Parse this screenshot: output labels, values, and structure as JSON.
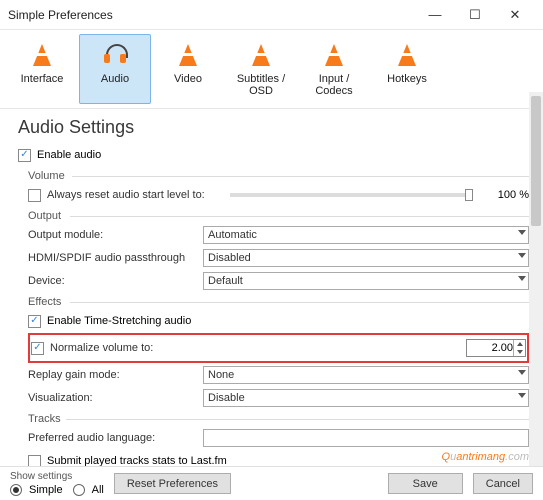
{
  "window": {
    "title": "Simple Preferences"
  },
  "tabs": {
    "interface": "Interface",
    "audio": "Audio",
    "video": "Video",
    "subtitles": "Subtitles / OSD",
    "input_codecs": "Input / Codecs",
    "hotkeys": "Hotkeys"
  },
  "page": {
    "heading": "Audio Settings",
    "enable_audio": "Enable audio",
    "volume_section": "Volume",
    "always_reset": "Always reset audio start level to:",
    "level_pct": "100 %",
    "output_section": "Output",
    "output_module": "Output module:",
    "output_module_val": "Automatic",
    "hdmi": "HDMI/SPDIF audio passthrough",
    "hdmi_val": "Disabled",
    "device": "Device:",
    "device_val": "Default",
    "effects_section": "Effects",
    "time_stretch": "Enable Time-Stretching audio",
    "normalize": "Normalize volume to:",
    "normalize_val": "2.00",
    "replay_gain": "Replay gain mode:",
    "replay_gain_val": "None",
    "visualization": "Visualization:",
    "visualization_val": "Disable",
    "tracks_section": "Tracks",
    "pref_lang": "Preferred audio language:",
    "lastfm": "Submit played tracks stats to Last.fm"
  },
  "footer": {
    "show_settings": "Show settings",
    "simple": "Simple",
    "all": "All",
    "reset": "Reset Preferences",
    "save": "Save",
    "cancel": "Cancel"
  },
  "watermark": {
    "a": "Q",
    "b": "u",
    "c": "antrimang",
    "d": ".com"
  }
}
